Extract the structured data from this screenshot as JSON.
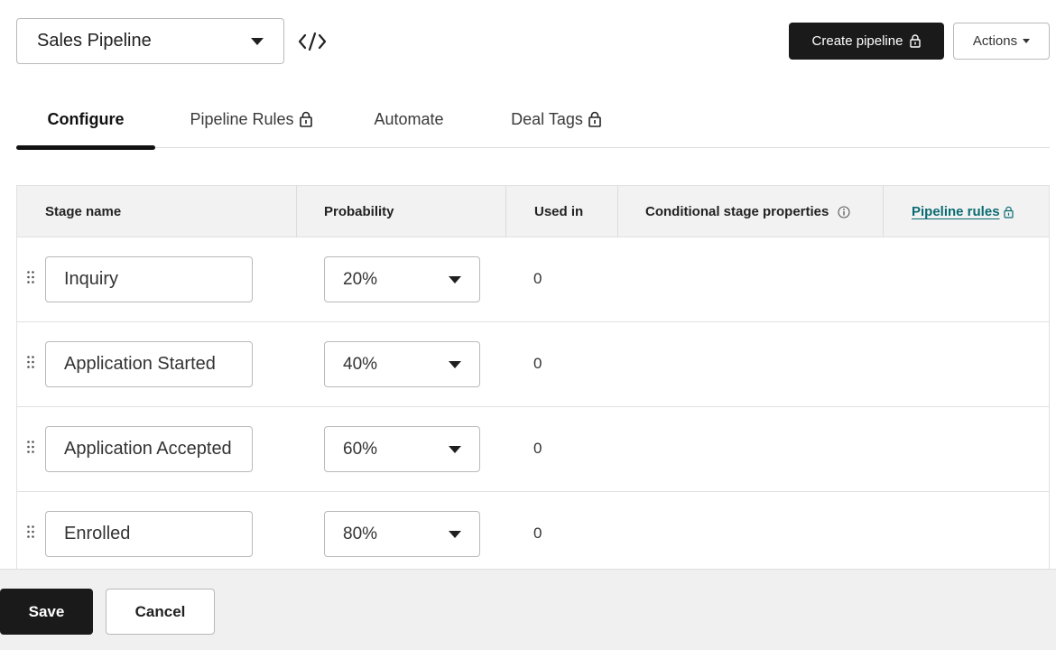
{
  "header": {
    "pipeline_select": {
      "value": "Sales Pipeline",
      "icon": "chevron-down-icon"
    },
    "embed_icon": "code-icon",
    "create_pipeline_label": "Create pipeline",
    "actions_label": "Actions"
  },
  "tabs": [
    {
      "label": "Configure",
      "active": true,
      "locked": false
    },
    {
      "label": "Pipeline Rules",
      "active": false,
      "locked": true
    },
    {
      "label": "Automate",
      "active": false,
      "locked": false
    },
    {
      "label": "Deal Tags",
      "active": false,
      "locked": true
    }
  ],
  "table": {
    "columns": {
      "stage_name": "Stage name",
      "probability": "Probability",
      "used_in": "Used in",
      "conditional": "Conditional stage properties",
      "pipeline_rules": "Pipeline rules"
    },
    "rows": [
      {
        "stage": "Inquiry",
        "probability": "20%",
        "used_in": "0"
      },
      {
        "stage": "Application Started",
        "probability": "40%",
        "used_in": "0"
      },
      {
        "stage": "Application Accepted",
        "probability": "60%",
        "used_in": "0"
      },
      {
        "stage": "Enrolled",
        "probability": "80%",
        "used_in": "0"
      }
    ]
  },
  "footer": {
    "save_label": "Save",
    "cancel_label": "Cancel"
  },
  "colors": {
    "primary_button": "#1a1a1a",
    "link": "#0a6b72",
    "header_bg": "#f2f2f2",
    "footer_bg": "#f0f0f0"
  }
}
